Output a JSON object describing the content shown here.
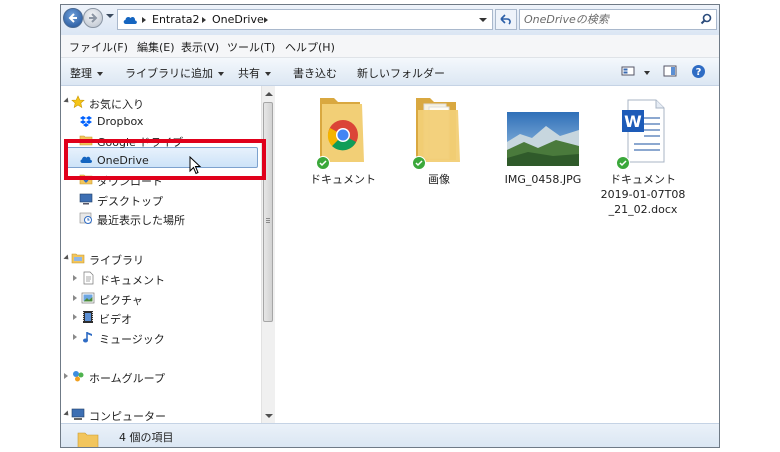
{
  "address": {
    "crumbs": [
      "Entrata2",
      "OneDrive"
    ],
    "search_placeholder": "OneDriveの検索"
  },
  "menu": [
    "ファイル(F)",
    "編集(E)",
    "表示(V)",
    "ツール(T)",
    "ヘルプ(H)"
  ],
  "toolbar": {
    "organize": "整理",
    "add_library": "ライブラリに追加",
    "share": "共有",
    "burn": "書き込む",
    "new_folder": "新しいフォルダー"
  },
  "nav": {
    "favorites": "お気に入り",
    "dropbox": "Dropbox",
    "google_drive": "Google ドライブ",
    "onedrive": "OneDrive",
    "downloads": "ダウンロード",
    "desktop": "デスクトップ",
    "recent": "最近表示した場所",
    "libraries": "ライブラリ",
    "documents": "ドキュメント",
    "pictures": "ピクチャ",
    "videos": "ビデオ",
    "music": "ミュージック",
    "homegroup": "ホームグループ",
    "computer": "コンピューター"
  },
  "files": [
    {
      "name": "ドキュメント",
      "type": "chrome-folder"
    },
    {
      "name": "画像",
      "type": "folder"
    },
    {
      "name": "IMG_0458.JPG",
      "type": "photo"
    },
    {
      "name": "ドキュメント 2019-01-07T08_21_02.docx",
      "line1": "ドキュメント",
      "line2": "2019-01-07T08",
      "line3": "_21_02.docx",
      "type": "word"
    }
  ],
  "status": {
    "count_text": "4 個の項目"
  },
  "colors": {
    "highlight": "#e0001b",
    "sync": "#3ba83b",
    "selection": "#cde3f8"
  }
}
